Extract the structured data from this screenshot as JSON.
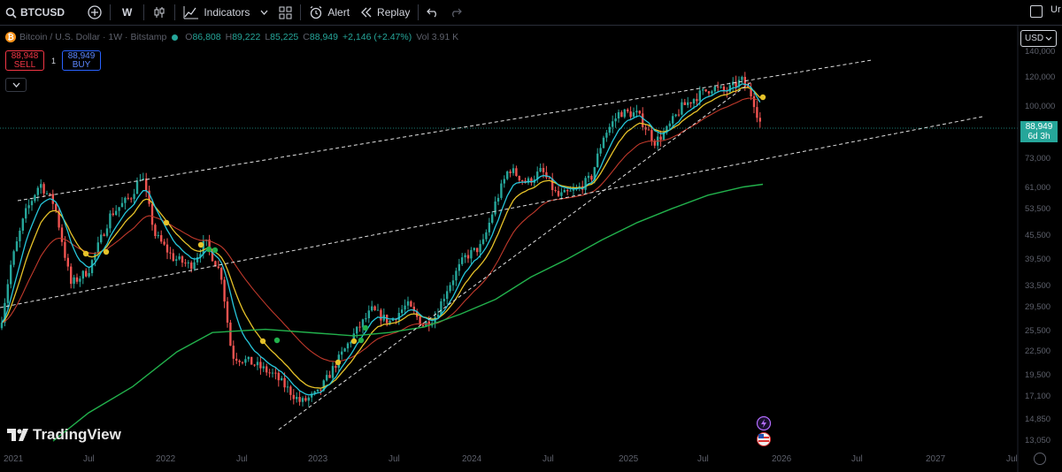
{
  "toolbar": {
    "symbol": "BTCUSD",
    "interval": "W",
    "indicators_label": "Indicators",
    "alert_label": "Alert",
    "replay_label": "Replay",
    "right_text": "Ur"
  },
  "legend": {
    "name": "Bitcoin / U.S. Dollar · 1W · Bitstamp",
    "open": "86,808",
    "high": "89,222",
    "low": "85,225",
    "close": "88,949",
    "change": "+2,146 (+2.47%)",
    "volume": "Vol 3.91 K"
  },
  "trade": {
    "sell_price": "88,948",
    "sell_label": "SELL",
    "spread": "1",
    "buy_price": "88,949",
    "buy_label": "BUY"
  },
  "currency": "USD",
  "price_tag": {
    "price": "88,949",
    "countdown": "6d 3h"
  },
  "brand": "TradingView",
  "colors": {
    "up": "#26a69a",
    "down": "#ef5350",
    "ema_fast": "#26c6da",
    "ema_mid": "#e6c229",
    "ema_slow": "#c0392b",
    "ma_long": "#22b14c"
  },
  "chart_data": {
    "type": "candlestick",
    "title": "Bitcoin / U.S. Dollar · 1W · Bitstamp",
    "y_scale": "log",
    "y_ticks": [
      140000,
      120000,
      100000,
      73000,
      61000,
      53500,
      45500,
      39500,
      33500,
      29500,
      25500,
      22500,
      19500,
      17100,
      14850,
      13050
    ],
    "x_ticks": [
      "2021",
      "Jul",
      "2022",
      "Jul",
      "2023",
      "Jul",
      "2024",
      "Jul",
      "2025",
      "Jul",
      "2026",
      "Jul",
      "2027",
      "Jul"
    ],
    "series": [
      {
        "name": "EMA fast",
        "color": "#26c6da"
      },
      {
        "name": "EMA mid",
        "color": "#e6c229"
      },
      {
        "name": "EMA slow",
        "color": "#c0392b"
      },
      {
        "name": "MA long",
        "color": "#22b14c"
      }
    ],
    "last_price": 88949,
    "annotations": [
      "ascending channel upper",
      "ascending channel lower",
      "support trendline"
    ]
  }
}
